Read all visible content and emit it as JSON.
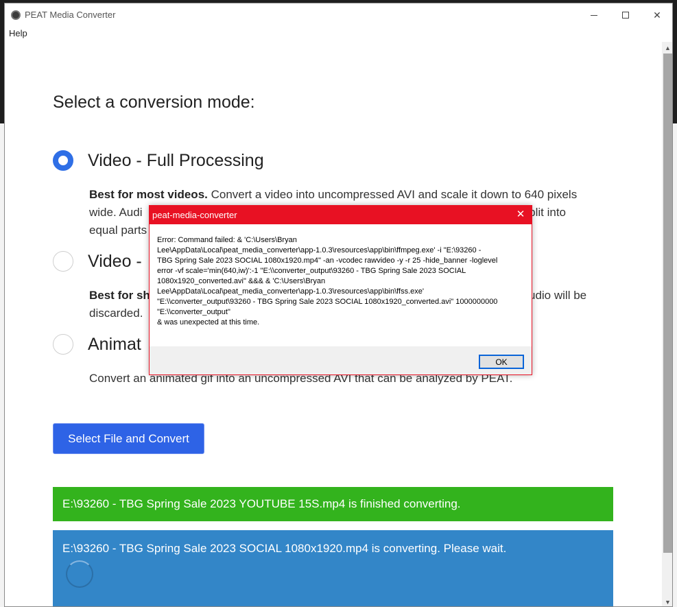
{
  "window": {
    "title": "PEAT Media Converter",
    "menu": [
      "Help"
    ]
  },
  "main": {
    "heading": "Select a conversion mode:",
    "options": [
      {
        "title": "Video - Full Processing",
        "desc_bold": "Best for most videos.",
        "desc_line1_rest": " Convert a video into uncompressed AVI and scale it down to 640 pixels",
        "desc_line2": "wide. Audi",
        "desc_line2_tail": "be split into",
        "desc_line3": "equal parts",
        "selected": true
      },
      {
        "title": "Video -",
        "desc_bold": "Best for sh",
        "desc_line1_tail": "udio will be",
        "desc_line2": "discarded.",
        "selected": false
      },
      {
        "title": "Animat",
        "desc_line1": "Convert an animated gif into an uncompressed AVI that can be analyzed by PEAT.",
        "selected": false
      }
    ],
    "convert_button": "Select File and Convert",
    "status_done": "E:\\93260 - TBG Spring Sale 2023 YOUTUBE 15S.mp4 is finished converting.",
    "status_progress": "E:\\93260 - TBG Spring Sale 2023 SOCIAL 1080x1920.mp4 is converting. Please wait."
  },
  "dialog": {
    "title": "peat-media-converter",
    "close_symbol": "✕",
    "message": "Error: Command failed: & 'C:\\Users\\Bryan\nLee\\AppData\\Local\\peat_media_converter\\app-1.0.3\\resources\\app\\bin\\ffmpeg.exe' -i \"E:\\93260 -\nTBG Spring Sale 2023 SOCIAL 1080x1920.mp4\" -an -vcodec rawvideo -y -r 25 -hide_banner -loglevel\nerror -vf scale='min(640,iw)':-1 \"E:\\\\converter_output\\93260 - TBG Spring Sale 2023 SOCIAL\n1080x1920_converted.avi\" &&& & 'C:\\Users\\Bryan\nLee\\AppData\\Local\\peat_media_converter\\app-1.0.3\\resources\\app\\bin\\ffss.exe'\n\"E:\\\\converter_output\\93260 - TBG Spring Sale 2023 SOCIAL 1080x1920_converted.avi\" 1000000000\n\"E:\\\\converter_output\"\n& was unexpected at this time.",
    "ok_label": "OK"
  },
  "colors": {
    "accent": "#2e63e6",
    "success": "#33b31d",
    "info": "#3386c8",
    "error_title": "#e81123"
  }
}
